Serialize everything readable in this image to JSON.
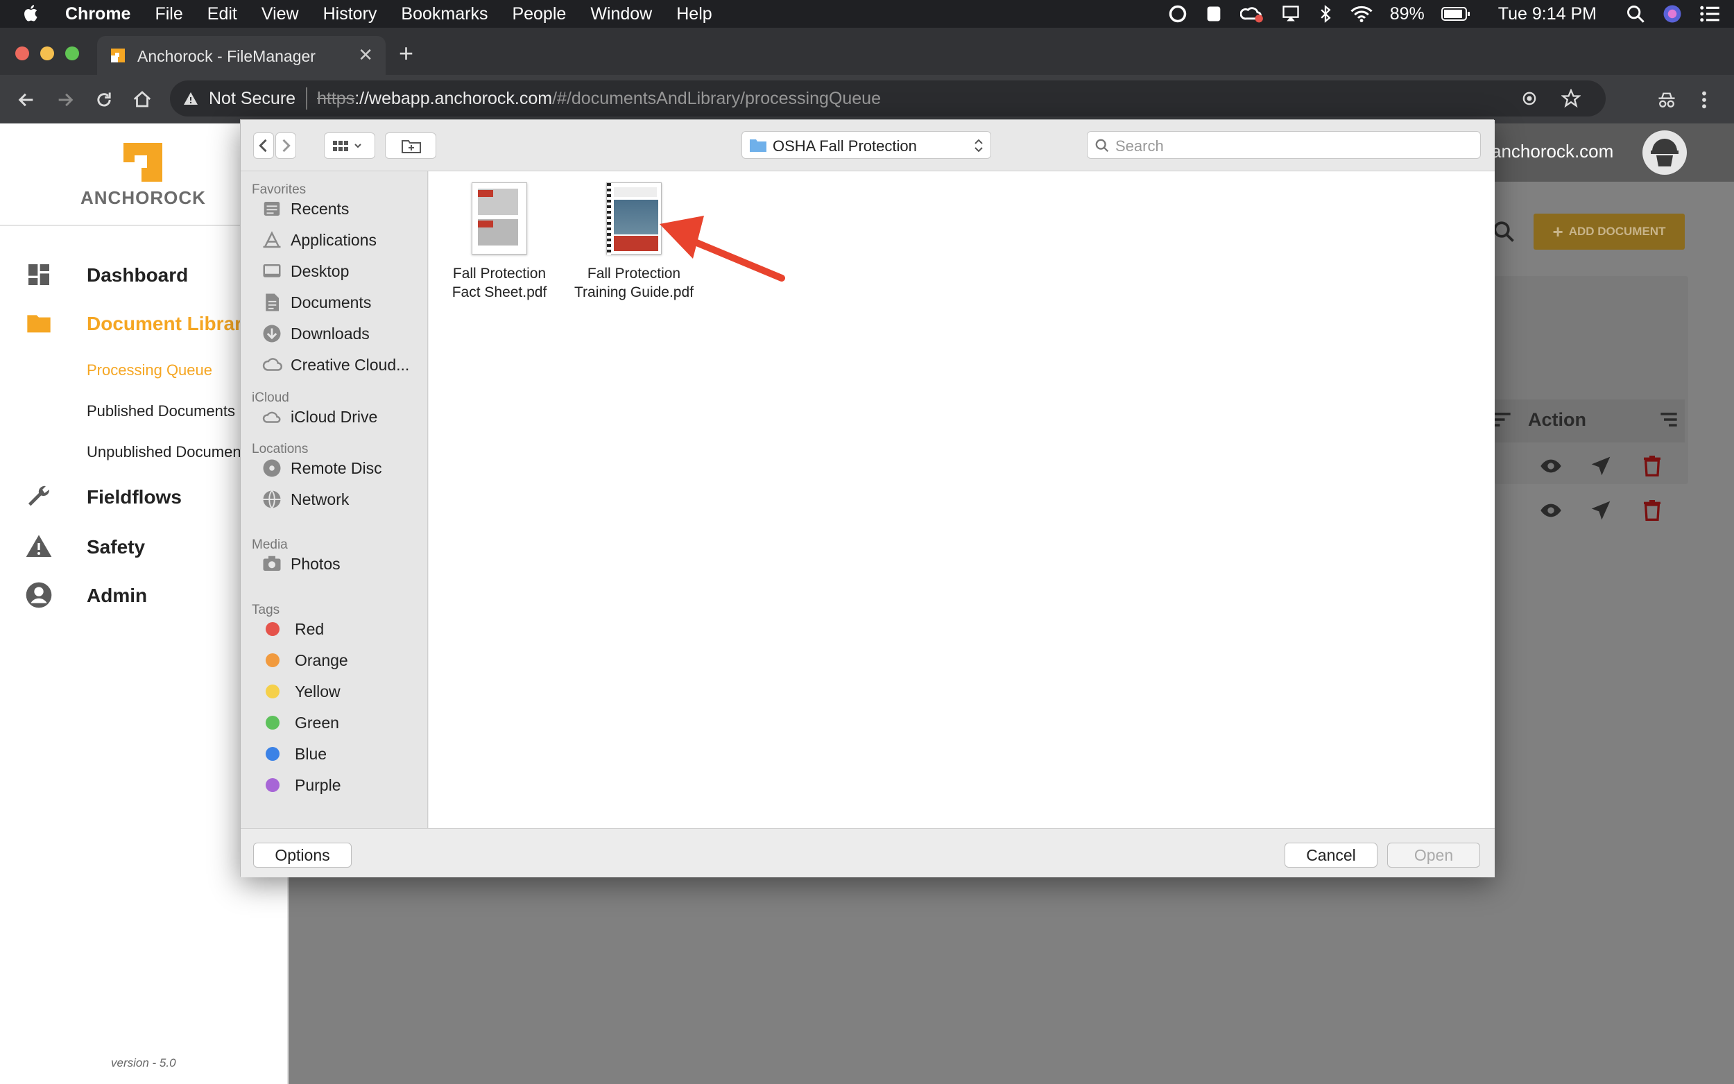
{
  "menubar": {
    "app": "Chrome",
    "items": [
      "File",
      "Edit",
      "View",
      "History",
      "Bookmarks",
      "People",
      "Window",
      "Help"
    ],
    "battery": "89%",
    "clock": "Tue 9:14 PM"
  },
  "browser": {
    "tab_title": "Anchorock - FileManager",
    "security_label": "Not Secure",
    "url_scheme": "https",
    "url_host": "://webapp.anchorock.com",
    "url_path": "/#/documentsAndLibrary/processingQueue"
  },
  "app": {
    "logo_text": "ANCHOROCK",
    "nav": {
      "dashboard": "Dashboard",
      "document_library": "Document Library",
      "processing_queue": "Processing Queue",
      "published_documents": "Published Documents",
      "unpublished_documents": "Unpublished Documen",
      "fieldflows": "Fieldflows",
      "safety": "Safety",
      "admin": "Admin"
    },
    "version": "version - 5.0",
    "user_email_partial": "anchorock.com",
    "add_document": "ADD DOCUMENT",
    "table_action_header": "Action",
    "accent_color": "#f5a623"
  },
  "dialog": {
    "current_folder": "OSHA Fall Protection",
    "search_placeholder": "Search",
    "sidebar": {
      "favorites_header": "Favorites",
      "favorites": [
        "Recents",
        "Applications",
        "Desktop",
        "Documents",
        "Downloads",
        "Creative Cloud..."
      ],
      "icloud_header": "iCloud",
      "icloud": [
        "iCloud Drive"
      ],
      "locations_header": "Locations",
      "locations": [
        "Remote Disc",
        "Network"
      ],
      "media_header": "Media",
      "media": [
        "Photos"
      ],
      "tags_header": "Tags",
      "tags": [
        {
          "name": "Red",
          "color": "#e5534b"
        },
        {
          "name": "Orange",
          "color": "#f19a3e"
        },
        {
          "name": "Yellow",
          "color": "#f5d04a"
        },
        {
          "name": "Green",
          "color": "#5dc15b"
        },
        {
          "name": "Blue",
          "color": "#3b82e6"
        },
        {
          "name": "Purple",
          "color": "#a766d6"
        }
      ]
    },
    "files": [
      {
        "line1": "Fall Protection",
        "line2": "Fact Sheet.pdf"
      },
      {
        "line1": "Fall Protection",
        "line2": "Training Guide.pdf"
      }
    ],
    "options_label": "Options",
    "cancel_label": "Cancel",
    "open_label": "Open"
  }
}
